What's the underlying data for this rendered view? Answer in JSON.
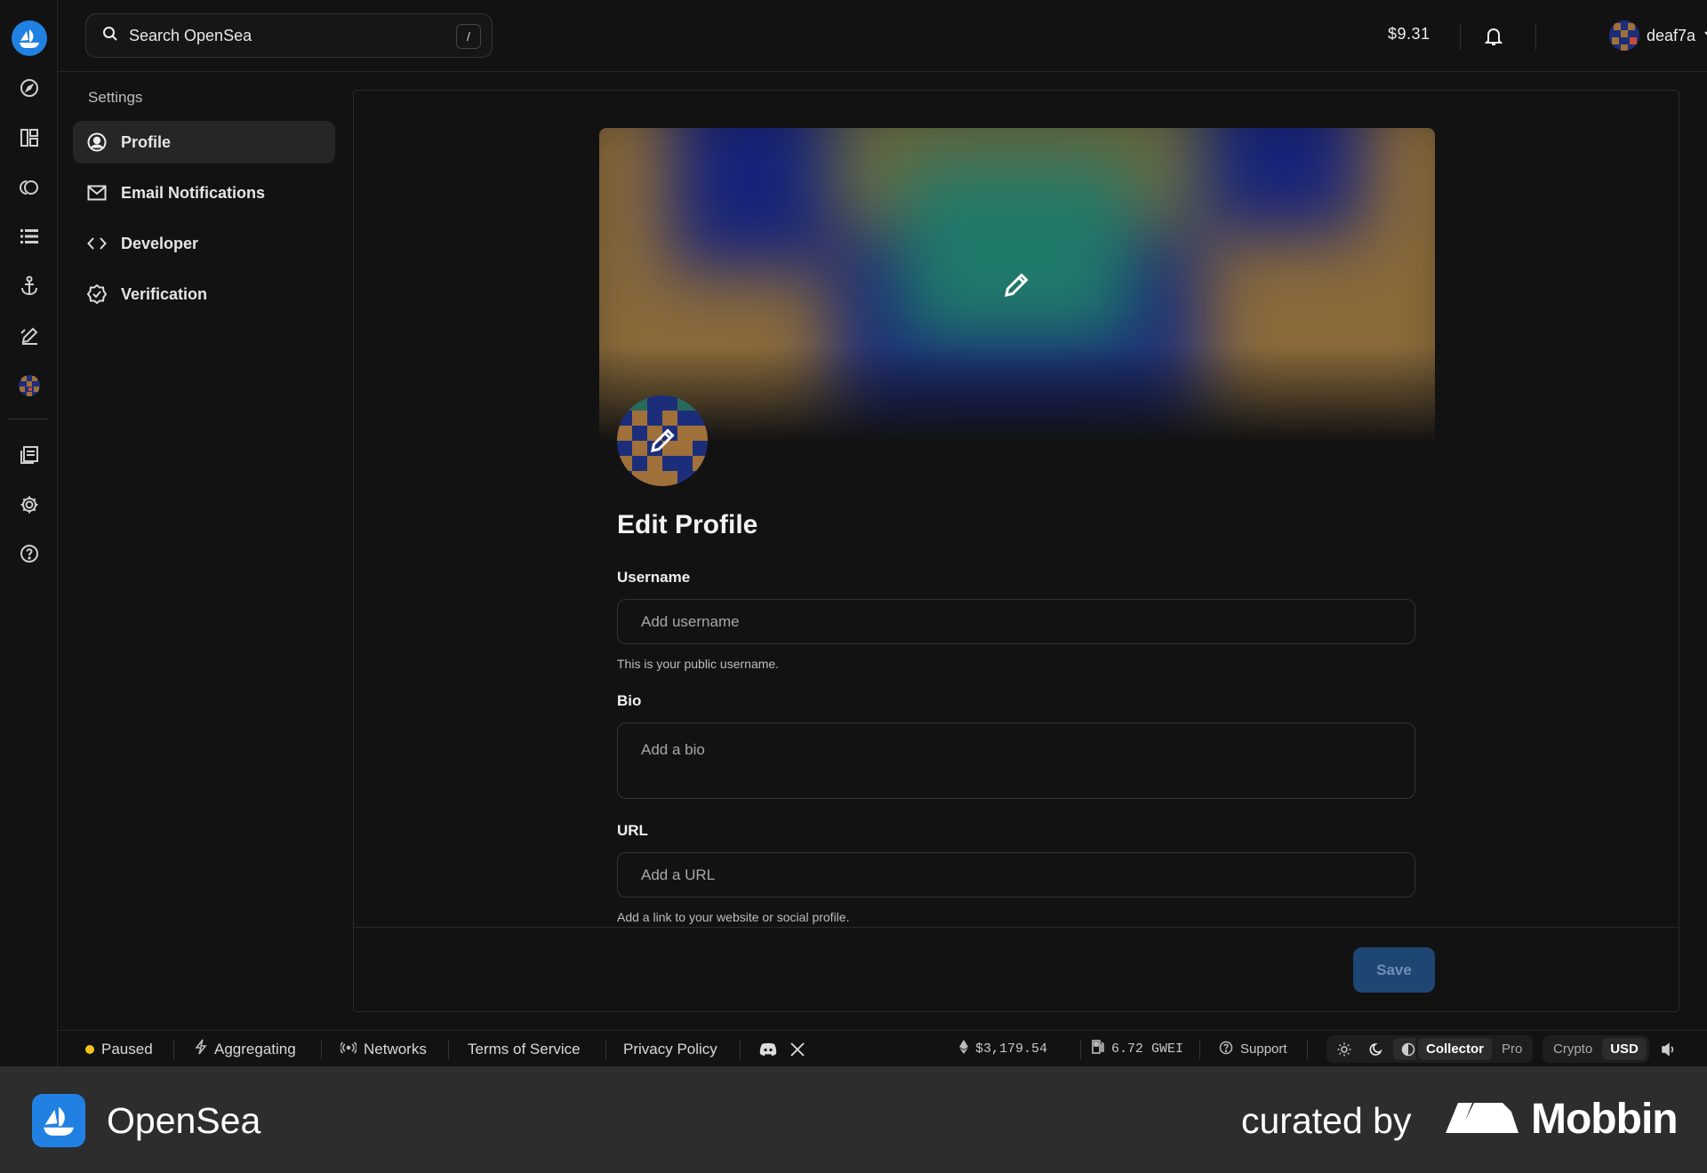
{
  "app": {
    "name": "OpenSea"
  },
  "search": {
    "placeholder": "Search OpenSea",
    "shortcut": "/"
  },
  "header": {
    "balance": "$9.31",
    "username": "deaf7a"
  },
  "rail": {
    "icons": [
      "opensea-logo-icon",
      "compass-icon",
      "dashboard-icon",
      "loop-icon",
      "list-icon",
      "anchor-icon",
      "pencil-create-icon",
      "profile-avatar-icon",
      "docs-icon",
      "settings-icon",
      "help-icon"
    ]
  },
  "settings_nav": {
    "title": "Settings",
    "items": [
      {
        "label": "Profile",
        "icon": "user-circle-icon",
        "active": true
      },
      {
        "label": "Email Notifications",
        "icon": "mail-icon",
        "active": false
      },
      {
        "label": "Developer",
        "icon": "code-icon",
        "active": false
      },
      {
        "label": "Verification",
        "icon": "badge-check-icon",
        "active": false
      }
    ]
  },
  "profile": {
    "heading": "Edit Profile",
    "username": {
      "label": "Username",
      "placeholder": "Add username",
      "help": "This is your public username."
    },
    "bio": {
      "label": "Bio",
      "placeholder": "Add a bio"
    },
    "url": {
      "label": "URL",
      "placeholder": "Add a URL",
      "help": "Add a link to your website or social profile."
    },
    "save_label": "Save"
  },
  "status_bar": {
    "paused": "Paused",
    "aggregating": "Aggregating",
    "networks": "Networks",
    "terms": "Terms of Service",
    "privacy": "Privacy Policy",
    "eth_price": "$3,179.54",
    "gas": "6.72 GWEI",
    "support": "Support",
    "mode": {
      "options": [
        "Collector",
        "Pro"
      ],
      "selected": "Collector"
    },
    "currency": {
      "options": [
        "Crypto",
        "USD"
      ],
      "selected": "USD"
    }
  },
  "footer": {
    "brand": "OpenSea",
    "curated_by": "curated by",
    "curator": "Mobbin"
  },
  "colors": {
    "accent": "#2081e2",
    "background": "#121212",
    "save_button": "#1d4673",
    "paused_dot": "#f4c21b"
  }
}
